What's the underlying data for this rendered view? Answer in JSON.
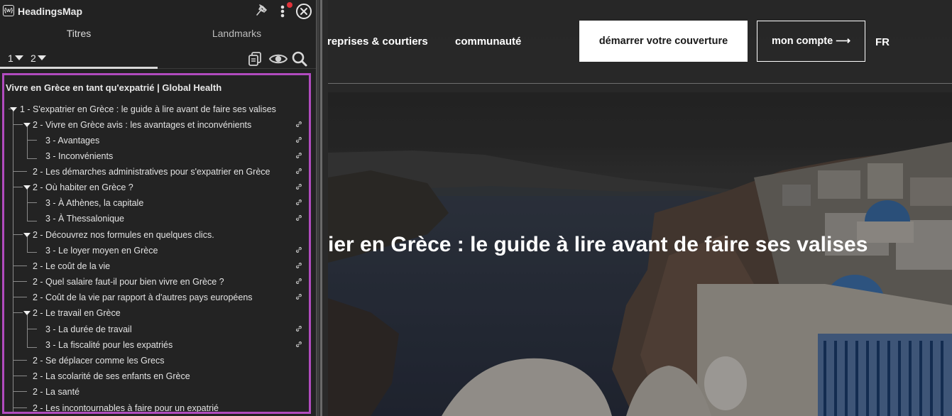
{
  "extension": {
    "title": "HeadingsMap",
    "logo_text": "{w}",
    "icons": [
      "pin-icon",
      "more-vertical-icon",
      "close-icon",
      "copy-icon",
      "eye-icon",
      "search-icon"
    ],
    "notification_color": "#e0323a"
  },
  "tabs": [
    {
      "label": "Titres",
      "active": true
    },
    {
      "label": "Landmarks",
      "active": false
    }
  ],
  "levels": [
    "1",
    "2"
  ],
  "tree": {
    "title": "Vivre en Grèce en tant qu'expatrié | Global Health",
    "highlight_color": "#b14bbf",
    "items": [
      {
        "level": 1,
        "text": "1 - S'expatrier en Grèce : le guide à lire avant de faire ses valises",
        "expanded": true,
        "link": false
      },
      {
        "level": 2,
        "text": "2 - Vivre en Grèce avis : les avantages et inconvénients",
        "expanded": true,
        "link": true
      },
      {
        "level": 3,
        "text": "3 - Avantages",
        "link": true
      },
      {
        "level": 3,
        "text": "3 - Inconvénients",
        "link": true
      },
      {
        "level": 2,
        "text": "2 - Les démarches administratives pour s'expatrier en Grèce",
        "link": true
      },
      {
        "level": 2,
        "text": "2 - Où habiter en Grèce ?",
        "expanded": true,
        "link": true
      },
      {
        "level": 3,
        "text": "3 - À Athènes, la capitale",
        "link": true
      },
      {
        "level": 3,
        "text": "3 - À Thessalonique",
        "link": true
      },
      {
        "level": 2,
        "text": "2 - Découvrez nos formules en quelques clics.",
        "expanded": true,
        "link": false
      },
      {
        "level": 3,
        "text": "3 - Le loyer moyen en Grèce",
        "link": true
      },
      {
        "level": 2,
        "text": "2 - Le coût de la vie",
        "link": true
      },
      {
        "level": 2,
        "text": "2 - Quel salaire faut-il pour bien vivre en Grèce ?",
        "link": true
      },
      {
        "level": 2,
        "text": "2 - Coût de la vie par rapport à d'autres pays européens",
        "link": true
      },
      {
        "level": 2,
        "text": "2 - Le travail en Grèce",
        "expanded": true,
        "link": false
      },
      {
        "level": 3,
        "text": "3 - La durée de travail",
        "link": true
      },
      {
        "level": 3,
        "text": "3 - La fiscalité pour les expatriés",
        "link": true
      },
      {
        "level": 2,
        "text": "2 - Se déplacer comme les Grecs",
        "link": false
      },
      {
        "level": 2,
        "text": "2 - La scolarité de ses enfants en Grèce",
        "link": false
      },
      {
        "level": 2,
        "text": "2 - La santé",
        "link": false
      },
      {
        "level": 2,
        "text": "2 - Les incontournables à faire pour un expatrié",
        "link": false
      }
    ]
  },
  "site": {
    "nav": {
      "links": [
        "treprises & courtiers",
        "communauté"
      ],
      "start_button": "démarrer votre couverture",
      "account_button": "mon compte ⟶",
      "lang": "FR"
    },
    "hero_title": "ier en Grèce : le guide à lire avant de faire ses valises"
  }
}
